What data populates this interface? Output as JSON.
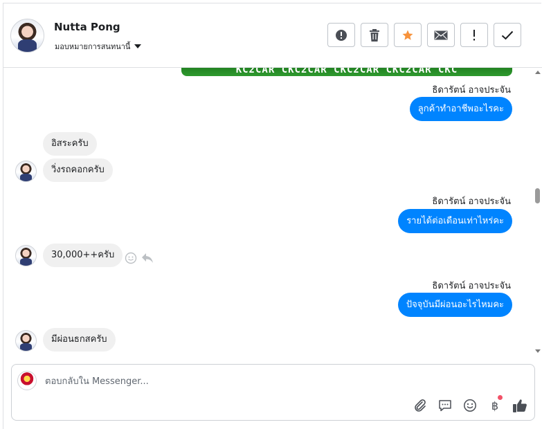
{
  "header": {
    "contact_name": "Nutta Pong",
    "assign_label": "มอบหมายการสนทนานี้",
    "toolbar": [
      {
        "name": "report-spam-button",
        "icon": "alert-circle-icon"
      },
      {
        "name": "delete-button",
        "icon": "trash-icon"
      },
      {
        "name": "star-button",
        "icon": "star-icon"
      },
      {
        "name": "mark-unread-button",
        "icon": "envelope-icon"
      },
      {
        "name": "follow-up-button",
        "icon": "exclamation-icon"
      },
      {
        "name": "mark-done-button",
        "icon": "checkmark-icon"
      }
    ]
  },
  "conversation": {
    "banner_text": "KC2CAR CKC2CAR CKC2CAR CKC2CAR CKC",
    "messages": [
      {
        "direction": "out",
        "sender": "ธิดารัตน์ อาจประจัน",
        "text": "ลูกค้าทำอาชีพอะไรคะ"
      },
      {
        "direction": "in",
        "text": "อิสระครับ"
      },
      {
        "direction": "in",
        "text": "วิ่งรถคอกครับ"
      },
      {
        "direction": "out",
        "sender": "ธิดารัตน์ อาจประจัน",
        "text": "รายได้ต่อเดือนเท่าไหร่คะ"
      },
      {
        "direction": "in",
        "text": "30,000++ครับ"
      },
      {
        "direction": "out",
        "sender": "ธิดารัตน์ อาจประจัน",
        "text": "ปัจจุบันมีผ่อนอะไรไหมคะ"
      },
      {
        "direction": "in",
        "text": "มีผ่อนธกสครับ"
      }
    ]
  },
  "composer": {
    "placeholder": "ตอบกลับใน Messenger...",
    "value": "",
    "currency_symbol": "฿",
    "has_notification_dot": true
  },
  "colors": {
    "outgoing_bubble": "#0084ff",
    "incoming_bubble": "#f0f0f0",
    "star": "#f7923b",
    "notification_dot": "#f25268"
  }
}
